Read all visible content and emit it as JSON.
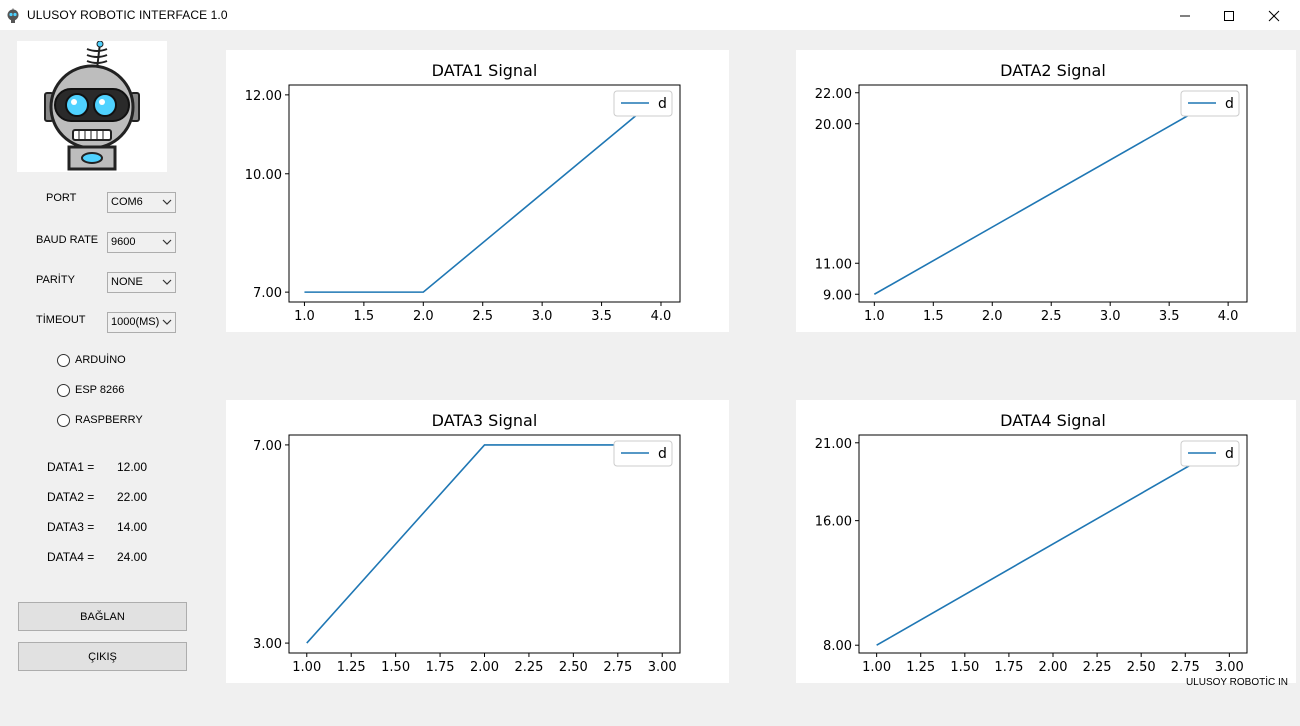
{
  "window": {
    "title": "ULUSOY ROBOTIC INTERFACE 1.0"
  },
  "settings": {
    "port": {
      "label": "PORT",
      "value": "COM6"
    },
    "baud": {
      "label": "BAUD RATE",
      "value": "9600"
    },
    "parity": {
      "label": "PARİTY",
      "value": "NONE"
    },
    "timeout": {
      "label": "TİMEOUT",
      "value": "1000(MS)"
    }
  },
  "boards": [
    "ARDUİNO",
    "ESP 8266",
    "RASPBERRY"
  ],
  "readings": [
    {
      "label": "DATA1 =",
      "value": "12.00"
    },
    {
      "label": "DATA2 =",
      "value": "22.00"
    },
    {
      "label": "DATA3 =",
      "value": "14.00"
    },
    {
      "label": "DATA4 =",
      "value": "24.00"
    }
  ],
  "buttons": {
    "connect": "BAĞLAN",
    "exit": "ÇIKIŞ"
  },
  "status": "ULUSOY ROBOTİC IN",
  "chart_data": [
    {
      "type": "line",
      "title": "DATA1 Signal",
      "x": [
        1,
        2,
        4
      ],
      "y": [
        7,
        7,
        12
      ],
      "xticks": [
        "1.0",
        "1.5",
        "2.0",
        "2.5",
        "3.0",
        "3.5",
        "4.0"
      ],
      "yticks": [
        "7.00",
        "10.00",
        "12.00"
      ],
      "xlim": [
        0.87,
        4.16
      ],
      "ylim": [
        6.75,
        12.25
      ],
      "legend": "d",
      "legend_position": "top-right",
      "color": "#1f77b4"
    },
    {
      "type": "line",
      "title": "DATA2 Signal",
      "x": [
        1,
        4
      ],
      "y": [
        9,
        22
      ],
      "xticks": [
        "1.0",
        "1.5",
        "2.0",
        "2.5",
        "3.0",
        "3.5",
        "4.0"
      ],
      "yticks": [
        "9.00",
        "11.00",
        "20.00",
        "22.00"
      ],
      "xlim": [
        0.87,
        4.16
      ],
      "ylim": [
        8.5,
        22.5
      ],
      "legend": "d",
      "legend_position": "top-right",
      "color": "#1f77b4"
    },
    {
      "type": "line",
      "title": "DATA3 Signal",
      "x": [
        1,
        2,
        3
      ],
      "y": [
        3,
        7,
        7
      ],
      "xticks": [
        "1.00",
        "1.25",
        "1.50",
        "1.75",
        "2.00",
        "2.25",
        "2.50",
        "2.75",
        "3.00"
      ],
      "yticks": [
        "3.00",
        "7.00"
      ],
      "xlim": [
        0.9,
        3.1
      ],
      "ylim": [
        2.8,
        7.2
      ],
      "legend": "d",
      "legend_position": "top-right",
      "color": "#1f77b4"
    },
    {
      "type": "line",
      "title": "DATA4 Signal",
      "x": [
        1,
        3
      ],
      "y": [
        8,
        21
      ],
      "xticks": [
        "1.00",
        "1.25",
        "1.50",
        "1.75",
        "2.00",
        "2.25",
        "2.50",
        "2.75",
        "3.00"
      ],
      "yticks": [
        "8.00",
        "16.00",
        "21.00"
      ],
      "xlim": [
        0.9,
        3.1
      ],
      "ylim": [
        7.5,
        21.5
      ],
      "legend": "d",
      "legend_position": "top-right",
      "color": "#1f77b4"
    }
  ]
}
